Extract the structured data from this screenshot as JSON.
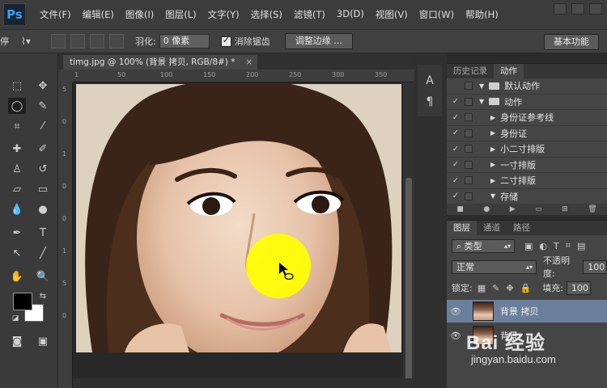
{
  "app": {
    "logo": "Ps"
  },
  "menu": [
    "文件(F)",
    "编辑(E)",
    "图像(I)",
    "图层(L)",
    "文字(Y)",
    "选择(S)",
    "滤镜(T)",
    "3D(D)",
    "视图(V)",
    "窗口(W)",
    "帮助(H)"
  ],
  "options_bar": {
    "feather_label": "羽化:",
    "feather_value": "0 像素",
    "antialias_label": "消除锯齿",
    "antialias_checked": true,
    "refine_edge_button": "调整边缘 ...",
    "workspace_button": "基本功能",
    "clipped_left_text": "停"
  },
  "document": {
    "tab_title": "timg.jpg @ 100% (背景 拷贝, RGB/8#) *",
    "close_glyph": "×",
    "ruler_h_ticks": [
      "1",
      "50",
      "100",
      "150",
      "200",
      "250",
      "300",
      "350"
    ],
    "ruler_v_ticks": [
      "5",
      "0",
      "1",
      "0",
      "0",
      "1",
      "5",
      "0"
    ]
  },
  "panel_actions": {
    "tabs": [
      "历史记录",
      "动作"
    ],
    "active_tab": "动作",
    "rows": [
      {
        "check": "",
        "expanded": true,
        "folder": true,
        "label": "默认动作",
        "indent": 0
      },
      {
        "check": "✓",
        "expanded": true,
        "folder": true,
        "label": "动作",
        "indent": 0
      },
      {
        "check": "✓",
        "expanded": false,
        "folder": false,
        "label": "身份证参考线",
        "indent": 1
      },
      {
        "check": "✓",
        "expanded": false,
        "folder": false,
        "label": "身份证",
        "indent": 1
      },
      {
        "check": "✓",
        "expanded": false,
        "folder": false,
        "label": "小二寸排版",
        "indent": 1
      },
      {
        "check": "✓",
        "expanded": false,
        "folder": false,
        "label": "一寸排版",
        "indent": 1
      },
      {
        "check": "✓",
        "expanded": false,
        "folder": false,
        "label": "二寸排版",
        "indent": 1
      },
      {
        "check": "✓",
        "expanded": true,
        "folder": false,
        "label": "存储",
        "indent": 1
      }
    ]
  },
  "panel_layers": {
    "tabs": [
      "图层",
      "通道",
      "路径"
    ],
    "active_tab": "图层",
    "kind_filter": "类型",
    "blend_mode": "正常",
    "opacity_label": "不透明度:",
    "opacity_value": "100",
    "lock_label": "锁定:",
    "fill_label": "填充:",
    "fill_value": "100",
    "layers": [
      {
        "name": "背景 拷贝",
        "selected": true,
        "visible": true
      },
      {
        "name": "背景",
        "selected": false,
        "visible": true
      }
    ]
  },
  "watermark": {
    "logo": "Bai 经验",
    "url": "jingyan.baidu.com"
  },
  "colors": {
    "selection_highlight": "#ffff00",
    "ps_blue": "#3aa0ff"
  }
}
